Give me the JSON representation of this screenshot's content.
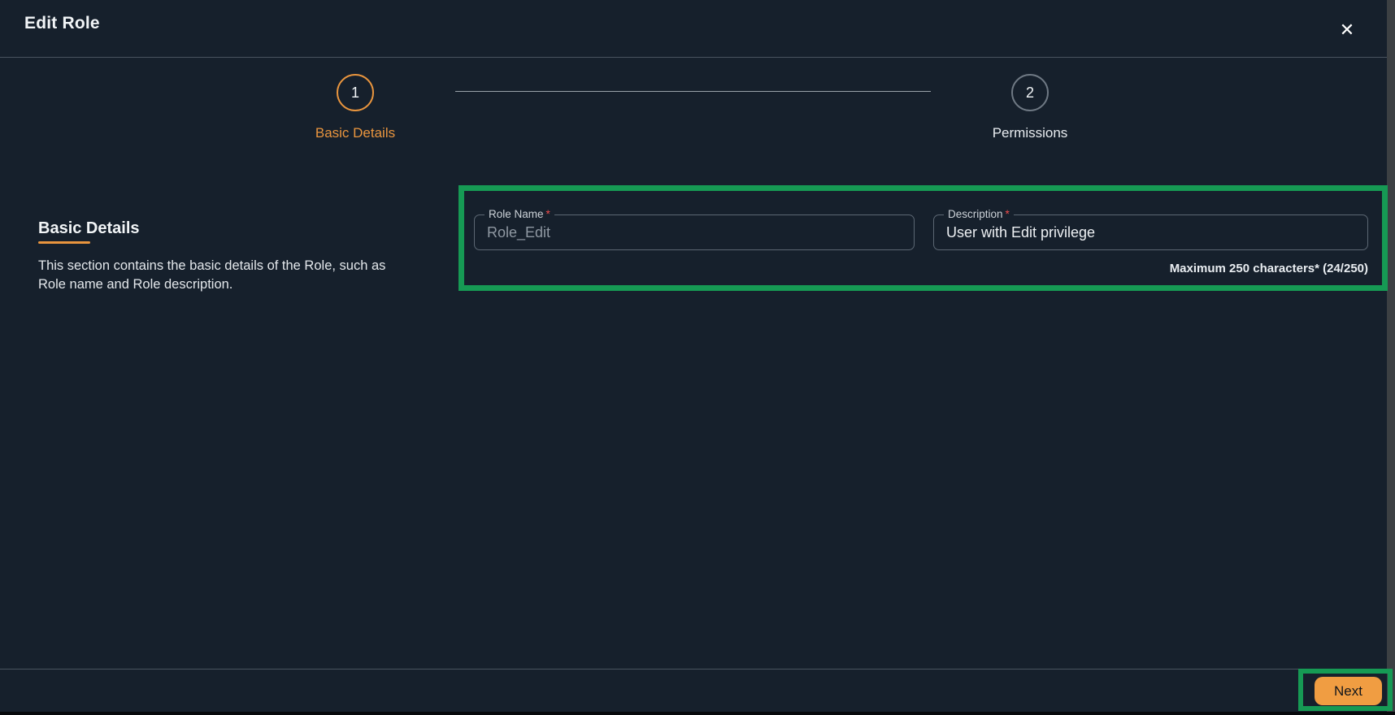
{
  "dialog": {
    "title": "Edit Role",
    "close_glyph": "✕"
  },
  "stepper": {
    "steps": [
      {
        "number": "1",
        "label": "Basic Details"
      },
      {
        "number": "2",
        "label": "Permissions"
      }
    ]
  },
  "section": {
    "heading": "Basic Details",
    "description": "This section contains the basic details of the Role, such as Role name and Role description."
  },
  "form": {
    "role_name": {
      "label": "Role Name",
      "required_marker": "*",
      "value": "Role_Edit"
    },
    "description": {
      "label": "Description",
      "required_marker": "*",
      "value": "User with Edit privilege",
      "helper": "Maximum 250 characters* (24/250)"
    }
  },
  "footer": {
    "next_label": "Next"
  },
  "colors": {
    "accent_orange": "#E9953E",
    "highlight_green": "#169A54",
    "background": "#16202C"
  }
}
